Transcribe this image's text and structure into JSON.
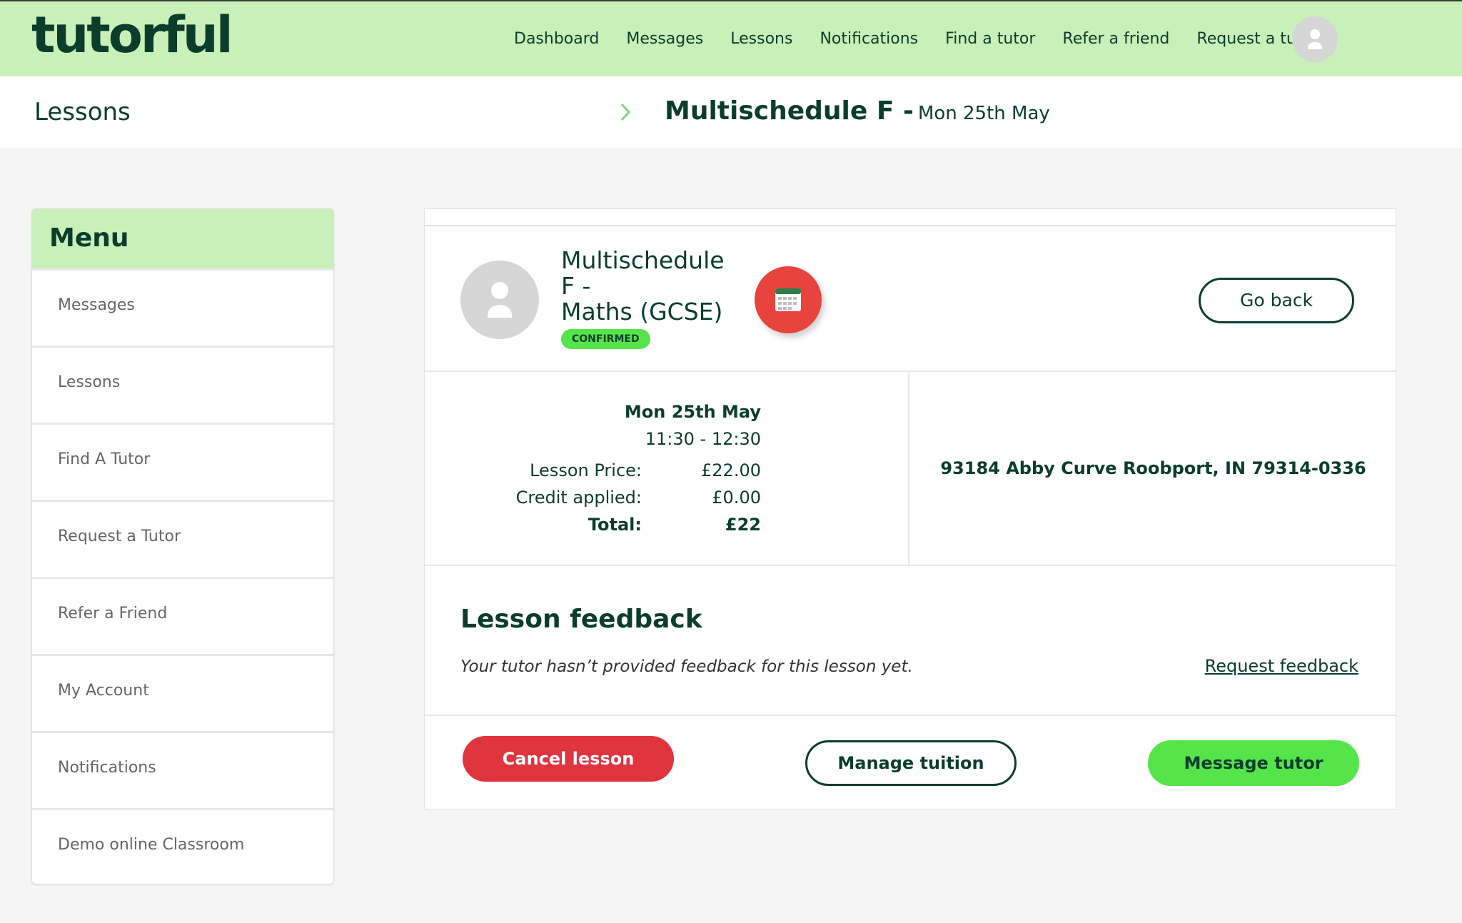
{
  "brand": {
    "logo_text": "tutorful",
    "primary_dark": "#0b3d2c",
    "light_green": "#c9f0b8",
    "accent_green": "#55e54a",
    "danger_red": "#e0343f"
  },
  "nav": {
    "items": [
      "Dashboard",
      "Messages",
      "Lessons",
      "Notifications",
      "Find a tutor",
      "Refer a friend",
      "Request a tutor"
    ],
    "avatar_icon": "user-icon"
  },
  "breadcrumb": {
    "root": "Lessons",
    "separator_icon": "chevron-right-icon",
    "title": "Multischedule F -",
    "date": "Mon 25th May"
  },
  "menu": {
    "heading": "Menu",
    "items": [
      "Messages",
      "Lessons",
      "Find A Tutor",
      "Request a Tutor",
      "Refer a Friend",
      "My Account",
      "Notifications",
      "Demo online Classroom"
    ]
  },
  "lesson": {
    "name_line1": "Multischedule",
    "name_line2": "F -",
    "name_line3": "Maths (GCSE)",
    "status": "CONFIRMED",
    "calendar_icon": "calendar-icon",
    "go_back": "Go back",
    "date": "Mon 25th May",
    "time": "11:30 - 12:30",
    "price_label": "Lesson Price:",
    "price_value": "£22.00",
    "credit_label": "Credit applied:",
    "credit_value": "£0.00",
    "total_label": "Total:",
    "total_value": "£22",
    "address": "93184 Abby Curve Roobport, IN 79314-0336"
  },
  "feedback": {
    "title": "Lesson feedback",
    "message": "Your tutor hasn’t provided feedback for this lesson yet.",
    "request_link": "Request feedback"
  },
  "actions": {
    "cancel": "Cancel lesson",
    "manage": "Manage tuition",
    "message": "Message tutor"
  }
}
